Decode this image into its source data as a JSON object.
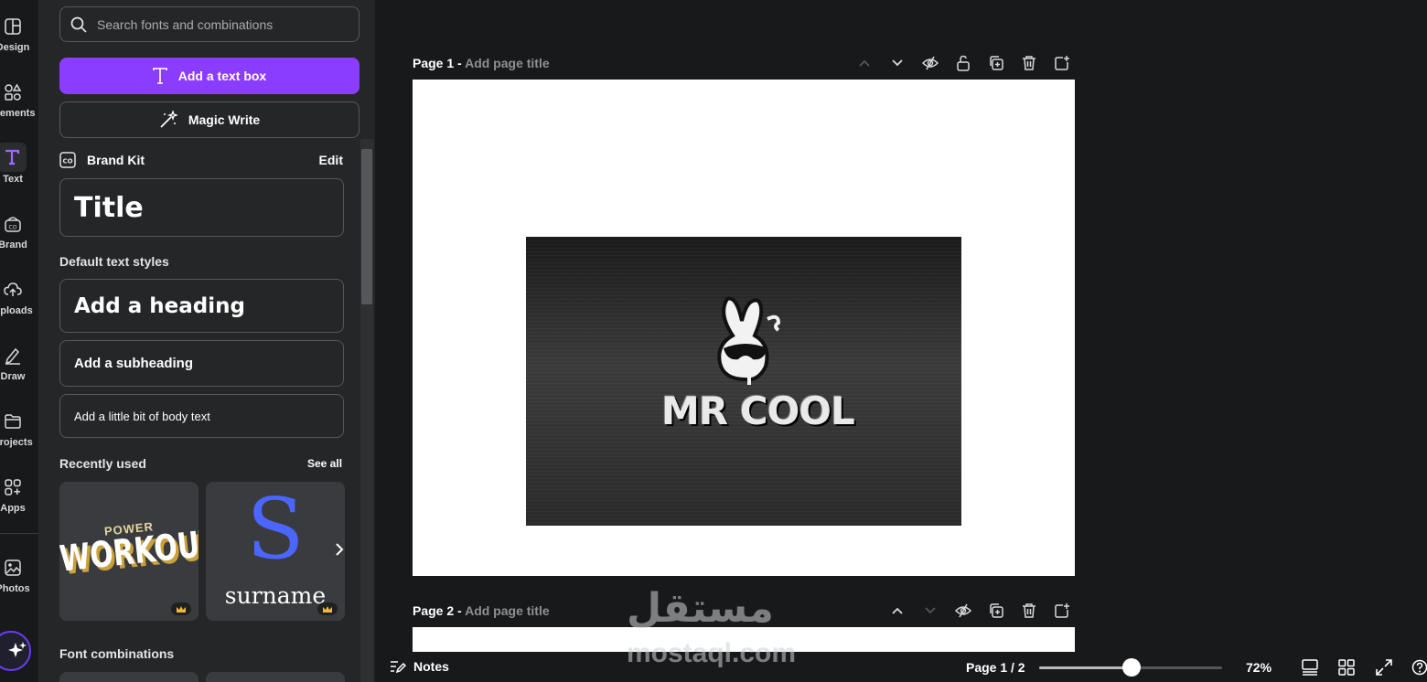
{
  "rail": {
    "items": [
      {
        "label": "Design",
        "icon": "layout-icon"
      },
      {
        "label": "Elements",
        "icon": "shapes-icon"
      },
      {
        "label": "Text",
        "icon": "text-icon"
      },
      {
        "label": "Brand",
        "icon": "brand-icon"
      },
      {
        "label": "Uploads",
        "icon": "cloud-upload-icon"
      },
      {
        "label": "Draw",
        "icon": "pen-icon"
      },
      {
        "label": "Projects",
        "icon": "folder-icon"
      },
      {
        "label": "Apps",
        "icon": "apps-icon"
      },
      {
        "label": "Photos",
        "icon": "image-icon"
      }
    ]
  },
  "panel": {
    "search_placeholder": "Search fonts and combinations",
    "add_textbox": "Add a text box",
    "magic_write": "Magic Write",
    "brand_kit": "Brand Kit",
    "brand_edit": "Edit",
    "brand_title": "Title",
    "default_styles_heading": "Default text styles",
    "heading": "Add a heading",
    "subheading": "Add a subheading",
    "body": "Add a little bit of body text",
    "recently_used": "Recently used",
    "see_all": "See all",
    "recent1_small": "POWER",
    "recent1_big": "WORKOUT",
    "recent2_letter": "S",
    "recent2_word": "surname",
    "font_combinations": "Font combinations"
  },
  "pages": [
    {
      "label": "Page 1 -",
      "title_placeholder": "Add page title"
    },
    {
      "label": "Page 2 -",
      "title_placeholder": "Add page title"
    }
  ],
  "design": {
    "logo_text": "MR COOL"
  },
  "bottom": {
    "notes": "Notes",
    "page_count": "Page 1 / 2",
    "zoom": "72%",
    "zoom_fraction": 0.51
  },
  "watermark": {
    "arabic": "مستقل",
    "latin": "mostaql.com"
  },
  "colors": {
    "accent": "#8b3dff",
    "panel": "#252627",
    "workspace": "#18191b"
  }
}
